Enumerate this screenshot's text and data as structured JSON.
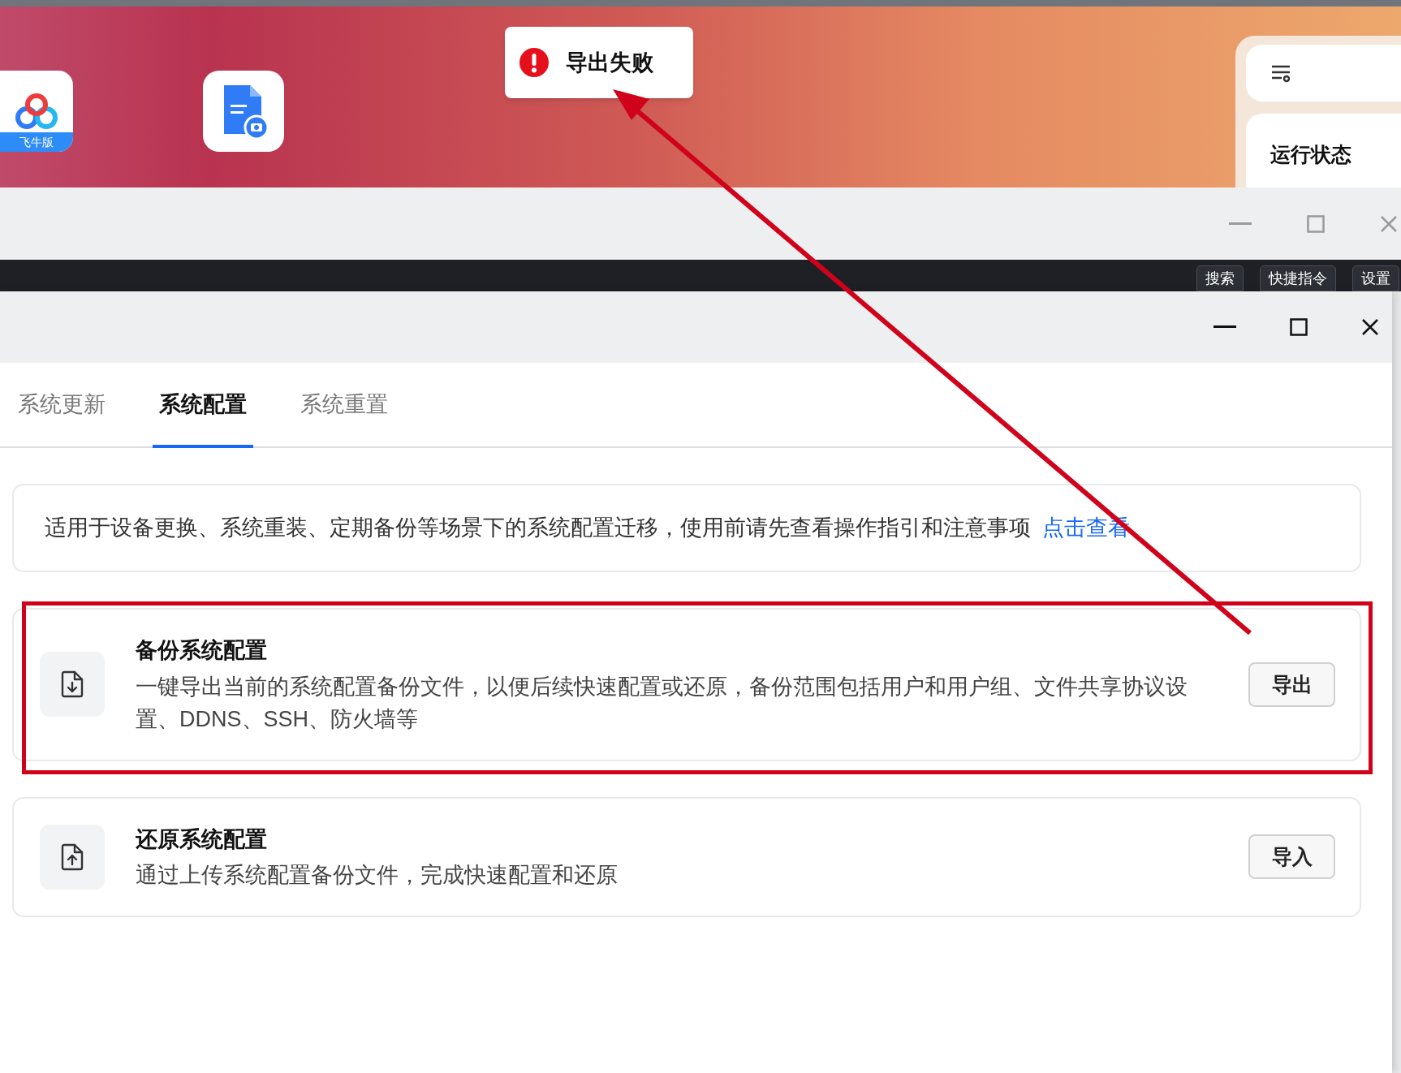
{
  "toast": {
    "text": "导出失败"
  },
  "desktop": {
    "app_badge": "飞牛版",
    "widget_title": "运行状态"
  },
  "back_window": {
    "toolbar_buttons": [
      "搜索",
      "快捷指令",
      "设置"
    ]
  },
  "tabs": [
    {
      "label": "系统更新",
      "selected": false
    },
    {
      "label": "系统配置",
      "selected": true
    },
    {
      "label": "系统重置",
      "selected": false
    }
  ],
  "notice": {
    "text": "适用于设备更换、系统重装、定期备份等场景下的系统配置迁移，使用前请先查看操作指引和注意事项",
    "link": "点击查看"
  },
  "cards": [
    {
      "kind": "export",
      "title": "备份系统配置",
      "description": "一键导出当前的系统配置备份文件，以便后续快速配置或还原，备份范围包括用户和用户组、文件共享协议设置、DDNS、SSH、防火墙等",
      "button": "导出",
      "highlighted": true
    },
    {
      "kind": "import",
      "title": "还原系统配置",
      "description": "通过上传系统配置备份文件，完成快速配置和还原",
      "button": "导入",
      "highlighted": false
    }
  ]
}
